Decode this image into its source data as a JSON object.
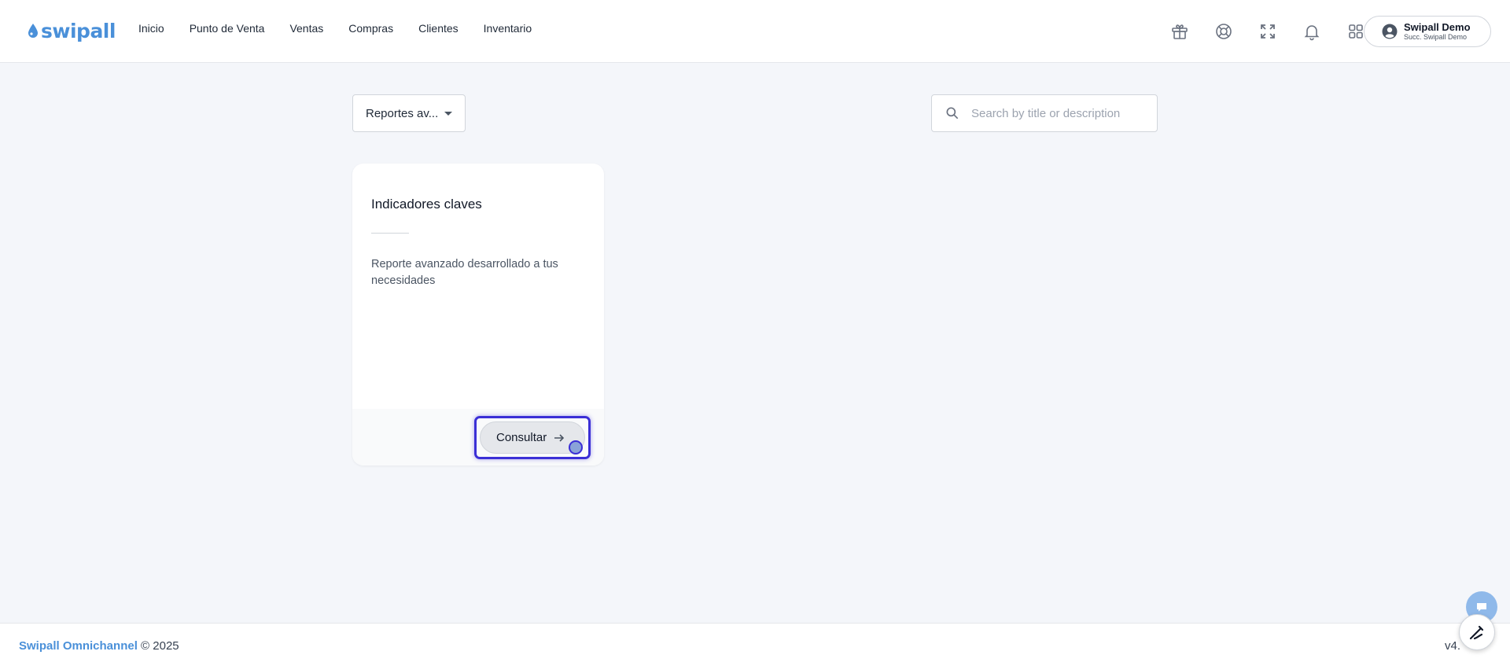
{
  "header": {
    "logo_text": "swipall",
    "nav": [
      "Inicio",
      "Punto de Venta",
      "Ventas",
      "Compras",
      "Clientes",
      "Inventario"
    ],
    "icons": [
      "gift-icon",
      "lifebuoy-icon",
      "fullscreen-icon",
      "bell-icon",
      "apps-grid-icon"
    ],
    "user": {
      "name": "Swipall Demo",
      "branch": "Succ. Swipall Demo"
    }
  },
  "filter": {
    "selected": "Reportes av..."
  },
  "search": {
    "placeholder": "Search by title or description",
    "value": ""
  },
  "cards": [
    {
      "title": "Indicadores claves",
      "description": "Reporte avanzado desarrollado a tus necesidades",
      "button_label": "Consultar"
    }
  ],
  "footer": {
    "brand": "Swipall Omnichannel",
    "copyright": "© 2025",
    "version": "v4."
  },
  "colors": {
    "brand": "#4a90d9",
    "focus_ring": "#3b2fd6",
    "background": "#f4f6fa"
  }
}
